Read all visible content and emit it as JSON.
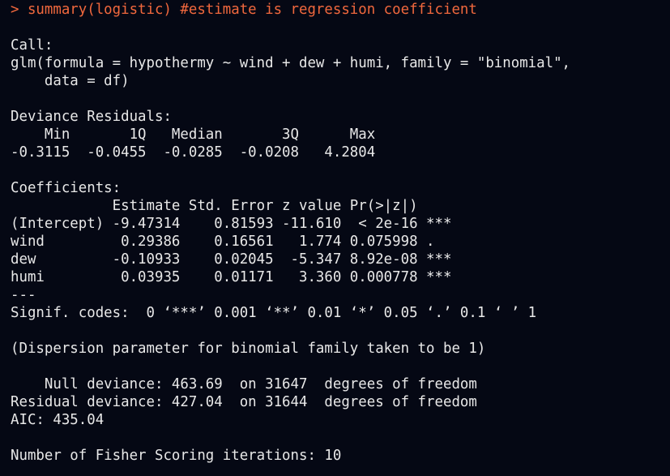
{
  "colors": {
    "background": "#050814",
    "output_text": "#e8e8e8",
    "command_text": "#f1683d"
  },
  "lines": [
    {
      "id": "prompt-line",
      "kind": "command",
      "text": "> summary(logistic) #estimate is regression coefficient"
    },
    {
      "id": "call-label",
      "kind": "output",
      "text": "Call:"
    },
    {
      "id": "call-formula-1",
      "kind": "output",
      "text": "glm(formula = hypothermy ~ wind + dew + humi, family = \"binomial\","
    },
    {
      "id": "call-formula-2",
      "kind": "output",
      "text": "    data = df)"
    },
    {
      "id": "deviance-residuals-label",
      "kind": "output",
      "text": "Deviance Residuals:"
    },
    {
      "id": "residuals-header",
      "kind": "output",
      "text": "    Min       1Q   Median       3Q      Max"
    },
    {
      "id": "residuals-values",
      "kind": "output",
      "text": "-0.3115  -0.0455  -0.0285  -0.0208   4.2804"
    },
    {
      "id": "coefficients-label",
      "kind": "output",
      "text": "Coefficients:"
    },
    {
      "id": "coef-header",
      "kind": "output",
      "text": "            Estimate Std. Error z value Pr(>|z|)"
    },
    {
      "id": "coef-row-intercept",
      "kind": "output",
      "text": "(Intercept) -9.47314    0.81593 -11.610  < 2e-16 ***"
    },
    {
      "id": "coef-row-wind",
      "kind": "output",
      "text": "wind         0.29386    0.16561   1.774 0.075998 ."
    },
    {
      "id": "coef-row-dew",
      "kind": "output",
      "text": "dew         -0.10933    0.02045  -5.347 8.92e-08 ***"
    },
    {
      "id": "coef-row-humi",
      "kind": "output",
      "text": "humi         0.03935    0.01171   3.360 0.000778 ***"
    },
    {
      "id": "separator",
      "kind": "output",
      "text": "---"
    },
    {
      "id": "signif-codes",
      "kind": "output",
      "text": "Signif. codes:  0 ‘***’ 0.001 ‘**’ 0.01 ‘*’ 0.05 ‘.’ 0.1 ‘ ’ 1"
    },
    {
      "id": "dispersion",
      "kind": "output",
      "text": "(Dispersion parameter for binomial family taken to be 1)"
    },
    {
      "id": "null-deviance",
      "kind": "output",
      "text": "    Null deviance: 463.69  on 31647  degrees of freedom"
    },
    {
      "id": "residual-deviance",
      "kind": "output",
      "text": "Residual deviance: 427.04  on 31644  degrees of freedom"
    },
    {
      "id": "aic",
      "kind": "output",
      "text": "AIC: 435.04"
    },
    {
      "id": "fisher-iterations",
      "kind": "output",
      "text": "Number of Fisher Scoring iterations: 10"
    }
  ]
}
